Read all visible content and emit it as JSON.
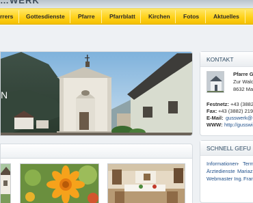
{
  "header": {
    "brand": "…WERK"
  },
  "nav": {
    "items": [
      "rrers",
      "Gottesdienste",
      "Pfarre",
      "Pfarrblatt",
      "Kirchen",
      "Fotos",
      "Aktuelles"
    ]
  },
  "hero": {
    "caption_letter": "N"
  },
  "contact": {
    "title": "KONTAKT",
    "org": "Pfarre G",
    "street": "Zur Wald",
    "city": "8632 Ma",
    "phone_label": "Festnetz:",
    "phone_value": "+43 (3882",
    "fax_label": "Fax:",
    "fax_value": "+43 (3882) 219",
    "email_label": "E-Mail:",
    "email_value": "gusswerk@",
    "www_label": "WWW:",
    "www_value": "http://gusswi"
  },
  "quick": {
    "title": "SCHNELL GEFU",
    "line1_a": "Informationen",
    "line1_sep": " - ",
    "line1_b": "Term",
    "line2_a": "Ärztedienste",
    "line2_b": "Mariaz",
    "line3_a": "Webmaster Ing.",
    "line3_b": "Frar"
  },
  "colors": {
    "nav_yellow": "#ffd21b",
    "link_blue": "#1f4f8a",
    "heading": "#2d4a62"
  }
}
